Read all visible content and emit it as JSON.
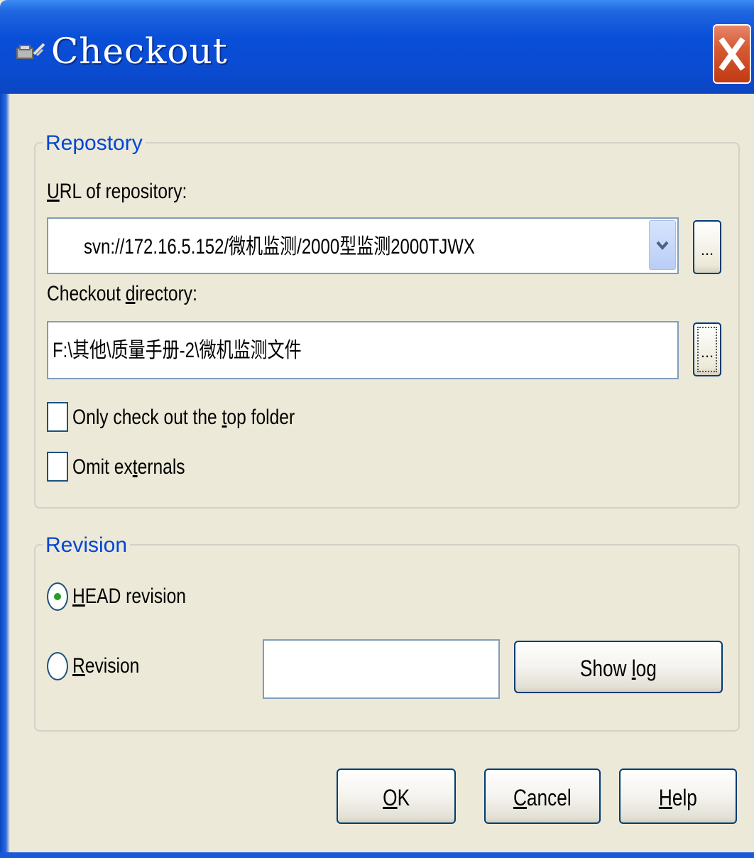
{
  "window": {
    "title": "Checkout"
  },
  "repository": {
    "group_label": "Repostory",
    "url_label": "URL of repository:",
    "url_value": "svn://172.16.5.152/微机监测/2000型监测2000TJWX",
    "browse_label": "...",
    "checkout_dir_label": "Checkout directory:",
    "checkout_dir_value": "F:\\其他\\质量手册-2\\微机监测文件",
    "only_top_folder_label": "Only check out the top folder",
    "only_top_folder_checked": false,
    "omit_externals_label": "Omit externals",
    "omit_externals_checked": false
  },
  "revision": {
    "group_label": "Revision",
    "head_label": "HEAD revision",
    "head_selected": true,
    "revision_label": "Revision",
    "revision_value": "",
    "show_log_label": "Show log"
  },
  "buttons": {
    "ok": "OK",
    "cancel": "Cancel",
    "help": "Help"
  },
  "colors": {
    "titlebar": "#0a4fd8",
    "dialog_bg": "#ece9d8",
    "group_label": "#0046d5",
    "close_button": "#d65a33"
  }
}
